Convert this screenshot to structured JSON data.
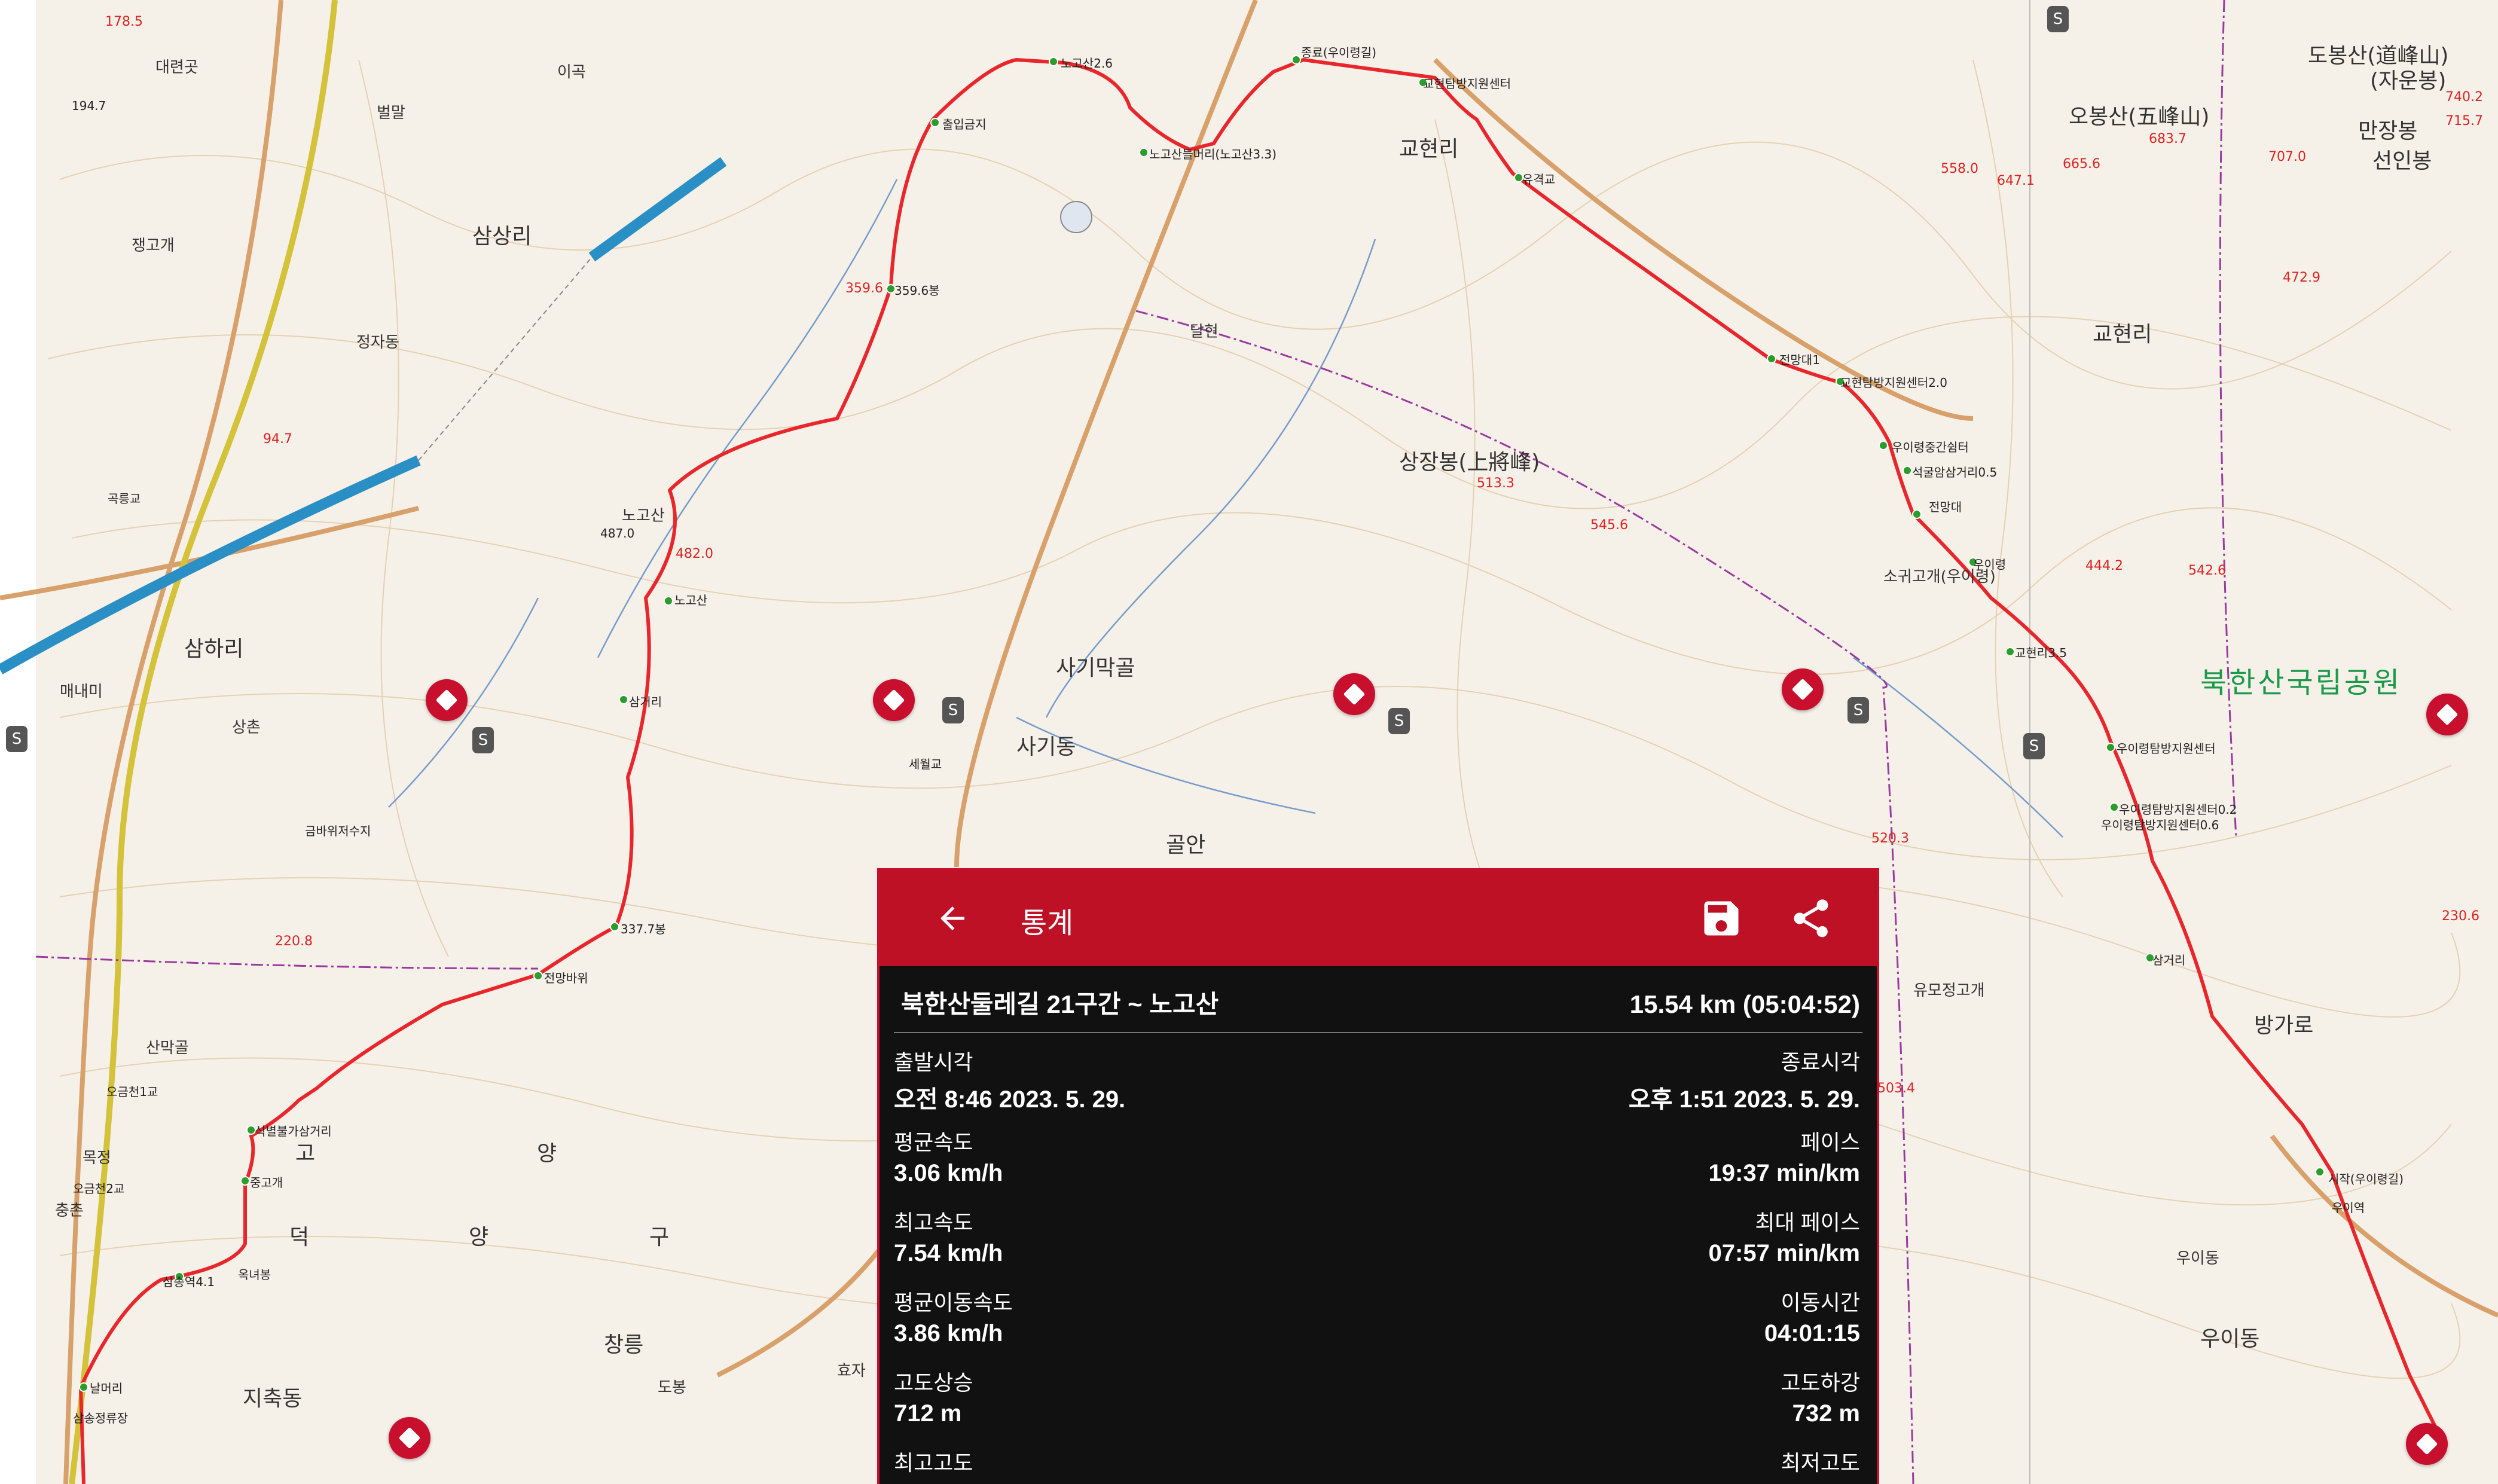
{
  "map": {
    "labels": {
      "l1": "178.5",
      "l2": "대련곳",
      "l3": "194.7",
      "l4": "벌말",
      "l5": "이곡",
      "l6": "삼상리",
      "l7": "쟁고개",
      "l8": "정자동",
      "l9": "94.7",
      "l10": "곡릉교",
      "l11": "노고산",
      "l12": "487.0",
      "l13": "482.0",
      "l14": "노고산",
      "l15": "삼하리",
      "l16": "상촌",
      "l17": "매내미",
      "l18": "금바위저수지",
      "l19": "220.8",
      "l20": "산막골",
      "l21": "오금천1교",
      "l22": "목정",
      "l23": "오금천2교",
      "l24": "충촌",
      "l25": "고",
      "l26": "양",
      "l27": "덕",
      "l28": "양",
      "l29": "구",
      "l30": "지축동",
      "l31": "노고산2.6",
      "l32": "출입금지",
      "l33": "노고산들머리(노고산3.3)",
      "l34": "359.6봉",
      "l35": "359.6",
      "l36": "삼거리",
      "l37": "337.7봉",
      "l38": "전망바위",
      "l39": "식별불가삼거리",
      "l40": "중고개",
      "l41": "삼송역4.1",
      "l42": "옥녀봉",
      "l43": "날머리",
      "l44": "삼송정류장",
      "l45": "종료(우이령길)",
      "l46": "교현탐방지원센터",
      "l47": "교현리",
      "l48": "유격교",
      "l49": "달현",
      "l50": "상장봉(上將峰)",
      "l51": "513.3",
      "l52": "545.6",
      "l53": "사기막골",
      "l54": "사기동",
      "l55": "골안",
      "l56": "세월교",
      "l57": "오봉산(五峰山)",
      "l58": "683.7",
      "l59": "665.6",
      "l60": "647.1",
      "l61": "558.0",
      "l62": "도봉산(道峰山)",
      "l63": "(자운봉)",
      "l64": "만장봉",
      "l65": "선인봉",
      "l66": "740.2",
      "l67": "715.7",
      "l68": "707.0",
      "l69": "472.9",
      "l70": "교현리",
      "l71": "전망대1",
      "l72": "교현탐방지원센터2.0",
      "l73": "우이령중간쉼터",
      "l74": "석굴암삼거리0.5",
      "l75": "전망대",
      "l76": "우이령",
      "l77": "444.2",
      "l78": "542.6",
      "l79": "교현리3.5",
      "l80": "북한산국립공원",
      "l81": "우이령탐방지원센터",
      "l82": "우이령탐방지원센터0.2",
      "l83": "우이령탐방지원센터0.6",
      "l84": "520.3",
      "l85": "삼거리",
      "l86": "230.6",
      "l87": "방가로",
      "l88": "503.4",
      "l89": "시작(우이령길)",
      "l90": "우이역",
      "l91": "우이동",
      "l92": "우이동",
      "l93": "창릉",
      "l94": "효자",
      "l95": "도봉",
      "l96": "유모정고개",
      "l97": "소귀고개(우이령)"
    },
    "icon_s": "S"
  },
  "panel": {
    "title": "통계",
    "route_name": "북한산둘레길 21구간 ~ 노고산",
    "total": "15.54 km (05:04:52)",
    "stats": [
      {
        "left_label": "출발시각",
        "left_value": "오전 8:46 2023. 5. 29.",
        "right_label": "종료시각",
        "right_value": "오후 1:51 2023. 5. 29."
      },
      {
        "left_label": "평균속도",
        "left_value": "3.06 km/h",
        "right_label": "페이스",
        "right_value": "19:37 min/km"
      },
      {
        "left_label": "최고속도",
        "left_value": "7.54 km/h",
        "right_label": "최대 페이스",
        "right_value": "07:57 min/km"
      },
      {
        "left_label": "평균이동속도",
        "left_value": "3.86 km/h",
        "right_label": "이동시간",
        "right_value": "04:01:15"
      },
      {
        "left_label": "고도상승",
        "left_value": "712 m",
        "right_label": "고도하강",
        "right_value": "732 m"
      },
      {
        "left_label": "최고고도",
        "left_value": "",
        "right_label": "최저고도",
        "right_value": ""
      }
    ]
  },
  "colors": {
    "accent": "#be1126",
    "route": "#e8262c",
    "park_text": "#1a9a4a"
  }
}
